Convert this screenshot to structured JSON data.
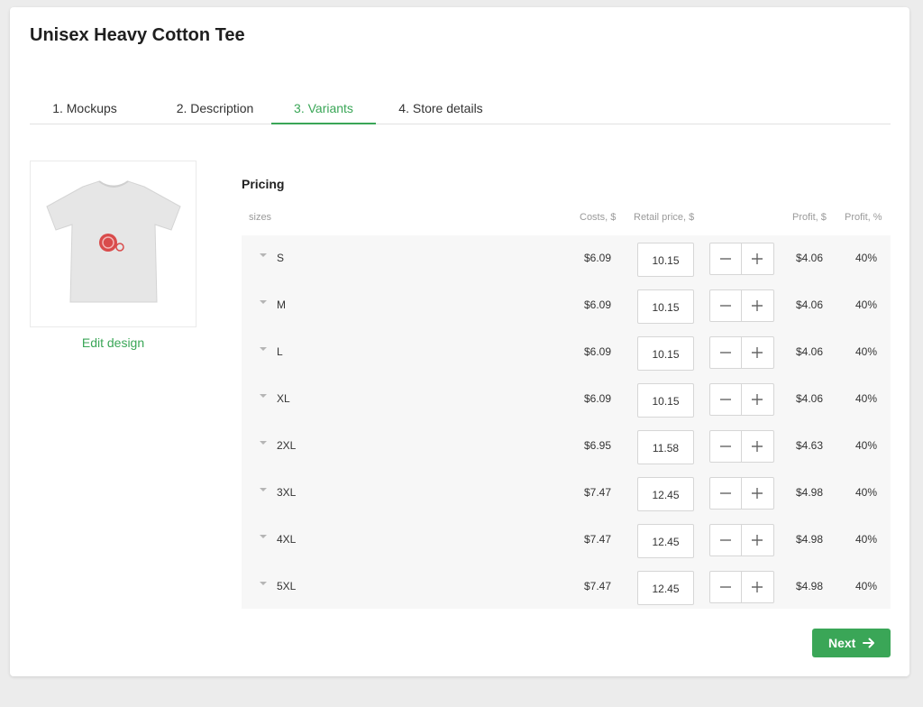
{
  "page": {
    "title": "Unisex Heavy Cotton Tee"
  },
  "tabs": [
    {
      "label": "1. Mockups",
      "active": false
    },
    {
      "label": "2. Description",
      "active": false
    },
    {
      "label": "3. Variants",
      "active": true
    },
    {
      "label": "4. Store details",
      "active": false
    }
  ],
  "mockup": {
    "edit_label": "Edit design",
    "icon": "tshirt-mockup-icon"
  },
  "pricing": {
    "title": "Pricing",
    "columns": {
      "sizes": "sizes",
      "costs": "Costs, $",
      "retail": "Retail price, $",
      "profit": "Profit, $",
      "profit_pct": "Profit, %"
    },
    "rows": [
      {
        "size": "S",
        "cost": "$6.09",
        "retail": "10.15",
        "profit": "$4.06",
        "profit_pct": "40%"
      },
      {
        "size": "M",
        "cost": "$6.09",
        "retail": "10.15",
        "profit": "$4.06",
        "profit_pct": "40%"
      },
      {
        "size": "L",
        "cost": "$6.09",
        "retail": "10.15",
        "profit": "$4.06",
        "profit_pct": "40%"
      },
      {
        "size": "XL",
        "cost": "$6.09",
        "retail": "10.15",
        "profit": "$4.06",
        "profit_pct": "40%"
      },
      {
        "size": "2XL",
        "cost": "$6.95",
        "retail": "11.58",
        "profit": "$4.63",
        "profit_pct": "40%"
      },
      {
        "size": "3XL",
        "cost": "$7.47",
        "retail": "12.45",
        "profit": "$4.98",
        "profit_pct": "40%"
      },
      {
        "size": "4XL",
        "cost": "$7.47",
        "retail": "12.45",
        "profit": "$4.98",
        "profit_pct": "40%"
      },
      {
        "size": "5XL",
        "cost": "$7.47",
        "retail": "12.45",
        "profit": "$4.98",
        "profit_pct": "40%"
      }
    ]
  },
  "actions": {
    "next_label": "Next"
  },
  "colors": {
    "accent": "#3aa657",
    "row_bg": "#f7f7f7"
  }
}
